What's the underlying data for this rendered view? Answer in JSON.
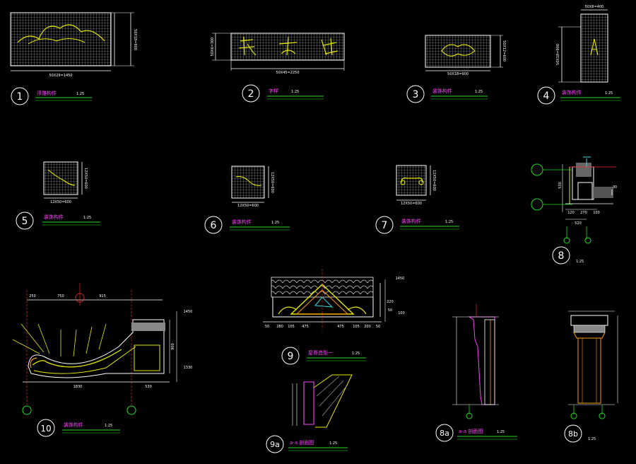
{
  "drawing": {
    "background": "#000000",
    "colors": {
      "white": "#ffffff",
      "green": "#22dd22",
      "yellow": "#e8e800",
      "cyan": "#33dddd",
      "red": "#ff3030",
      "magenta": "#ff40ff",
      "orange": "#ff9900",
      "gray": "#9a9a9a"
    },
    "details": [
      {
        "number": "1",
        "title": "浮雕构件",
        "scale": "1:25",
        "dim_width": "50X29=1450",
        "dim_height": "50X18=900"
      },
      {
        "number": "2",
        "title": "字样",
        "scale": "1:25",
        "dim_width": "50X45=2250",
        "dim_height": "50X6=300"
      },
      {
        "number": "3",
        "title": "装饰构件",
        "scale": "1:25",
        "dim_width": "50X18=900",
        "dim_height": "50X12=600"
      },
      {
        "number": "4",
        "title": "装饰构件",
        "scale": "1:25",
        "dim_width": "50X8=400",
        "dim_height": "50X18=900"
      },
      {
        "number": "5",
        "title": "装饰构件",
        "scale": "1:25",
        "dim_width": "12X50=600",
        "dim_height": "12X50=600"
      },
      {
        "number": "6",
        "title": "装饰构件",
        "scale": "1:25",
        "dim_width": "12X50=600",
        "dim_height": "12X50=600"
      },
      {
        "number": "7",
        "title": "装饰构件",
        "scale": "1:25",
        "dim_width": "12X50=600",
        "dim_height": "12X50=600"
      },
      {
        "number": "8",
        "title": "",
        "scale": "1:25",
        "dims": [
          "520",
          "120",
          "270",
          "100",
          "30",
          "530"
        ]
      },
      {
        "number": "9",
        "title": "屋脊造型一",
        "scale": "1:25",
        "dims": [
          "1450",
          "280",
          "105",
          "475",
          "475",
          "105",
          "200",
          "50",
          "220",
          "50",
          "50",
          "100"
        ]
      },
      {
        "number": "10",
        "title": "装饰构件",
        "scale": "1:25",
        "dims": [
          "250",
          "750",
          "915",
          "1830",
          "530",
          "900",
          "1450",
          "1330"
        ]
      },
      {
        "number": "9a",
        "title": "a-a 剖面图",
        "scale": "1:25"
      },
      {
        "number": "8a",
        "title": "a-a 剖面图",
        "scale": "1:25"
      },
      {
        "number": "8b",
        "title": "",
        "scale": "1:25"
      }
    ]
  }
}
